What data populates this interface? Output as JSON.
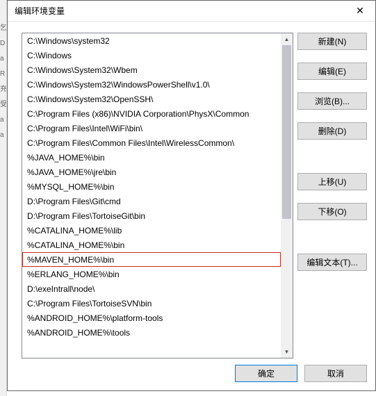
{
  "left_fragments": [
    "乞",
    "D",
    "a",
    "R",
    "",
    "",
    "",
    "",
    "",
    "",
    "",
    "",
    "",
    "",
    "",
    "充",
    "受",
    "",
    "",
    "a",
    "",
    "",
    "a"
  ],
  "dialog": {
    "title": "编辑环境变量",
    "close_glyph": "✕",
    "list_items": [
      "C:\\Windows\\system32",
      "C:\\Windows",
      "C:\\Windows\\System32\\Wbem",
      "C:\\Windows\\System32\\WindowsPowerShell\\v1.0\\",
      "C:\\Windows\\System32\\OpenSSH\\",
      "C:\\Program Files (x86)\\NVIDIA Corporation\\PhysX\\Common",
      "C:\\Program Files\\Intel\\WiFi\\bin\\",
      "C:\\Program Files\\Common Files\\Intel\\WirelessCommon\\",
      "%JAVA_HOME%\\bin",
      "%JAVA_HOME%\\jre\\bin",
      "%MYSQL_HOME%\\bin",
      "D:\\Program Files\\Git\\cmd",
      "D:\\Program Files\\TortoiseGit\\bin",
      "%CATALINA_HOME%\\lib",
      "%CATALINA_HOME%\\bin",
      "%MAVEN_HOME%\\bin",
      "%ERLANG_HOME%\\bin",
      "D:\\exeIntrall\\node\\",
      "C:\\Program Files\\TortoiseSVN\\bin",
      "%ANDROID_HOME%\\platform-tools",
      "%ANDROID_HOME%\\tools"
    ],
    "highlight_index": 15,
    "buttons": {
      "new": "新建(N)",
      "edit": "编辑(E)",
      "browse": "浏览(B)...",
      "delete": "删除(D)",
      "move_up": "上移(U)",
      "move_down": "下移(O)",
      "edit_text": "编辑文本(T)...",
      "ok": "确定",
      "cancel": "取消"
    },
    "scroll": {
      "up_glyph": "▲",
      "down_glyph": "▼"
    }
  }
}
